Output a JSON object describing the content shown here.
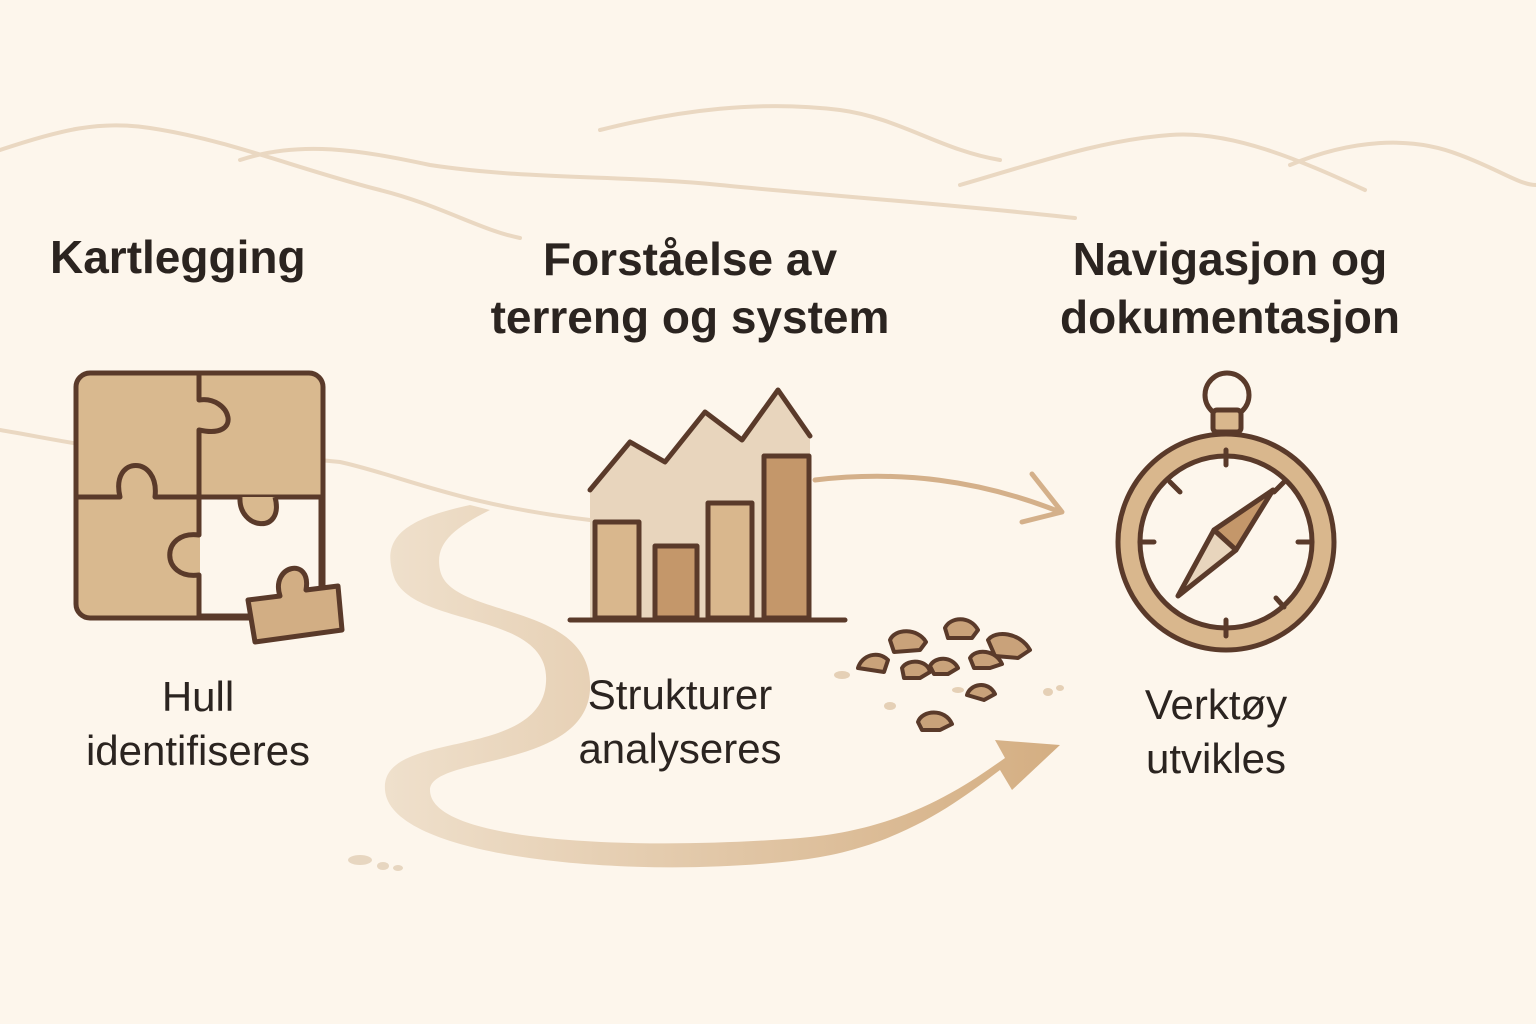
{
  "steps": [
    {
      "heading": [
        "Kartlegging"
      ],
      "caption": [
        "Hull",
        "identifiseres"
      ],
      "icon": "puzzle-icon"
    },
    {
      "heading": [
        "Forståelse av",
        "terreng og system"
      ],
      "caption": [
        "Strukturer",
        "analyseres"
      ],
      "icon": "bar-chart-icon"
    },
    {
      "heading": [
        "Navigasjon og",
        "dokumentasjon"
      ],
      "caption": [
        "Verktøy",
        "utvikles"
      ],
      "icon": "compass-icon"
    }
  ],
  "colors": {
    "background": "#fdf6ec",
    "tan_light": "#e7d3b8",
    "tan": "#d9b78d",
    "tan_dark": "#c4976a",
    "outline": "#5a3a2a",
    "hills": "#ead8c2",
    "text": "#2b2420"
  }
}
